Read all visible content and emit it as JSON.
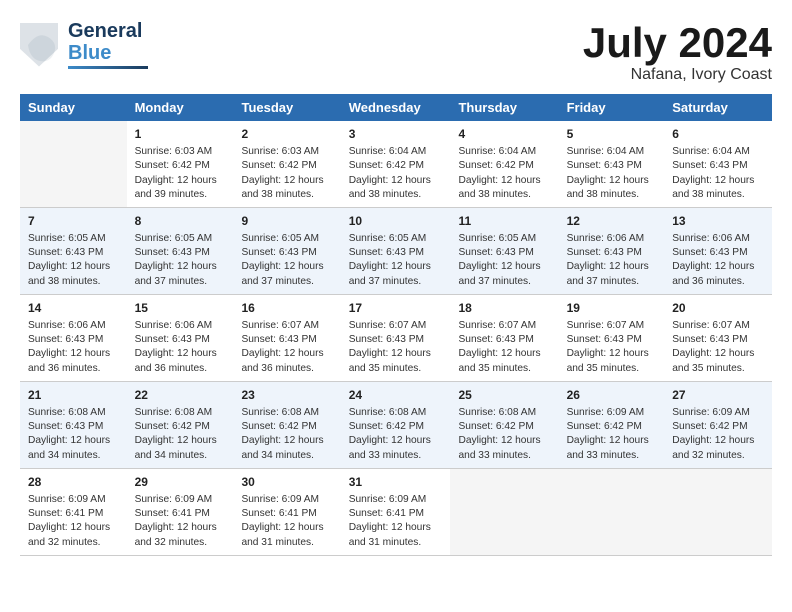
{
  "header": {
    "logo_line1": "General",
    "logo_line2": "Blue",
    "month": "July 2024",
    "location": "Nafana, Ivory Coast"
  },
  "columns": [
    "Sunday",
    "Monday",
    "Tuesday",
    "Wednesday",
    "Thursday",
    "Friday",
    "Saturday"
  ],
  "rows": [
    [
      {
        "day": "",
        "info": ""
      },
      {
        "day": "1",
        "info": "Sunrise: 6:03 AM\nSunset: 6:42 PM\nDaylight: 12 hours\nand 39 minutes."
      },
      {
        "day": "2",
        "info": "Sunrise: 6:03 AM\nSunset: 6:42 PM\nDaylight: 12 hours\nand 38 minutes."
      },
      {
        "day": "3",
        "info": "Sunrise: 6:04 AM\nSunset: 6:42 PM\nDaylight: 12 hours\nand 38 minutes."
      },
      {
        "day": "4",
        "info": "Sunrise: 6:04 AM\nSunset: 6:42 PM\nDaylight: 12 hours\nand 38 minutes."
      },
      {
        "day": "5",
        "info": "Sunrise: 6:04 AM\nSunset: 6:43 PM\nDaylight: 12 hours\nand 38 minutes."
      },
      {
        "day": "6",
        "info": "Sunrise: 6:04 AM\nSunset: 6:43 PM\nDaylight: 12 hours\nand 38 minutes."
      }
    ],
    [
      {
        "day": "7",
        "info": "Sunrise: 6:05 AM\nSunset: 6:43 PM\nDaylight: 12 hours\nand 38 minutes."
      },
      {
        "day": "8",
        "info": "Sunrise: 6:05 AM\nSunset: 6:43 PM\nDaylight: 12 hours\nand 37 minutes."
      },
      {
        "day": "9",
        "info": "Sunrise: 6:05 AM\nSunset: 6:43 PM\nDaylight: 12 hours\nand 37 minutes."
      },
      {
        "day": "10",
        "info": "Sunrise: 6:05 AM\nSunset: 6:43 PM\nDaylight: 12 hours\nand 37 minutes."
      },
      {
        "day": "11",
        "info": "Sunrise: 6:05 AM\nSunset: 6:43 PM\nDaylight: 12 hours\nand 37 minutes."
      },
      {
        "day": "12",
        "info": "Sunrise: 6:06 AM\nSunset: 6:43 PM\nDaylight: 12 hours\nand 37 minutes."
      },
      {
        "day": "13",
        "info": "Sunrise: 6:06 AM\nSunset: 6:43 PM\nDaylight: 12 hours\nand 36 minutes."
      }
    ],
    [
      {
        "day": "14",
        "info": "Sunrise: 6:06 AM\nSunset: 6:43 PM\nDaylight: 12 hours\nand 36 minutes."
      },
      {
        "day": "15",
        "info": "Sunrise: 6:06 AM\nSunset: 6:43 PM\nDaylight: 12 hours\nand 36 minutes."
      },
      {
        "day": "16",
        "info": "Sunrise: 6:07 AM\nSunset: 6:43 PM\nDaylight: 12 hours\nand 36 minutes."
      },
      {
        "day": "17",
        "info": "Sunrise: 6:07 AM\nSunset: 6:43 PM\nDaylight: 12 hours\nand 35 minutes."
      },
      {
        "day": "18",
        "info": "Sunrise: 6:07 AM\nSunset: 6:43 PM\nDaylight: 12 hours\nand 35 minutes."
      },
      {
        "day": "19",
        "info": "Sunrise: 6:07 AM\nSunset: 6:43 PM\nDaylight: 12 hours\nand 35 minutes."
      },
      {
        "day": "20",
        "info": "Sunrise: 6:07 AM\nSunset: 6:43 PM\nDaylight: 12 hours\nand 35 minutes."
      }
    ],
    [
      {
        "day": "21",
        "info": "Sunrise: 6:08 AM\nSunset: 6:43 PM\nDaylight: 12 hours\nand 34 minutes."
      },
      {
        "day": "22",
        "info": "Sunrise: 6:08 AM\nSunset: 6:42 PM\nDaylight: 12 hours\nand 34 minutes."
      },
      {
        "day": "23",
        "info": "Sunrise: 6:08 AM\nSunset: 6:42 PM\nDaylight: 12 hours\nand 34 minutes."
      },
      {
        "day": "24",
        "info": "Sunrise: 6:08 AM\nSunset: 6:42 PM\nDaylight: 12 hours\nand 33 minutes."
      },
      {
        "day": "25",
        "info": "Sunrise: 6:08 AM\nSunset: 6:42 PM\nDaylight: 12 hours\nand 33 minutes."
      },
      {
        "day": "26",
        "info": "Sunrise: 6:09 AM\nSunset: 6:42 PM\nDaylight: 12 hours\nand 33 minutes."
      },
      {
        "day": "27",
        "info": "Sunrise: 6:09 AM\nSunset: 6:42 PM\nDaylight: 12 hours\nand 32 minutes."
      }
    ],
    [
      {
        "day": "28",
        "info": "Sunrise: 6:09 AM\nSunset: 6:41 PM\nDaylight: 12 hours\nand 32 minutes."
      },
      {
        "day": "29",
        "info": "Sunrise: 6:09 AM\nSunset: 6:41 PM\nDaylight: 12 hours\nand 32 minutes."
      },
      {
        "day": "30",
        "info": "Sunrise: 6:09 AM\nSunset: 6:41 PM\nDaylight: 12 hours\nand 31 minutes."
      },
      {
        "day": "31",
        "info": "Sunrise: 6:09 AM\nSunset: 6:41 PM\nDaylight: 12 hours\nand 31 minutes."
      },
      {
        "day": "",
        "info": ""
      },
      {
        "day": "",
        "info": ""
      },
      {
        "day": "",
        "info": ""
      }
    ]
  ]
}
